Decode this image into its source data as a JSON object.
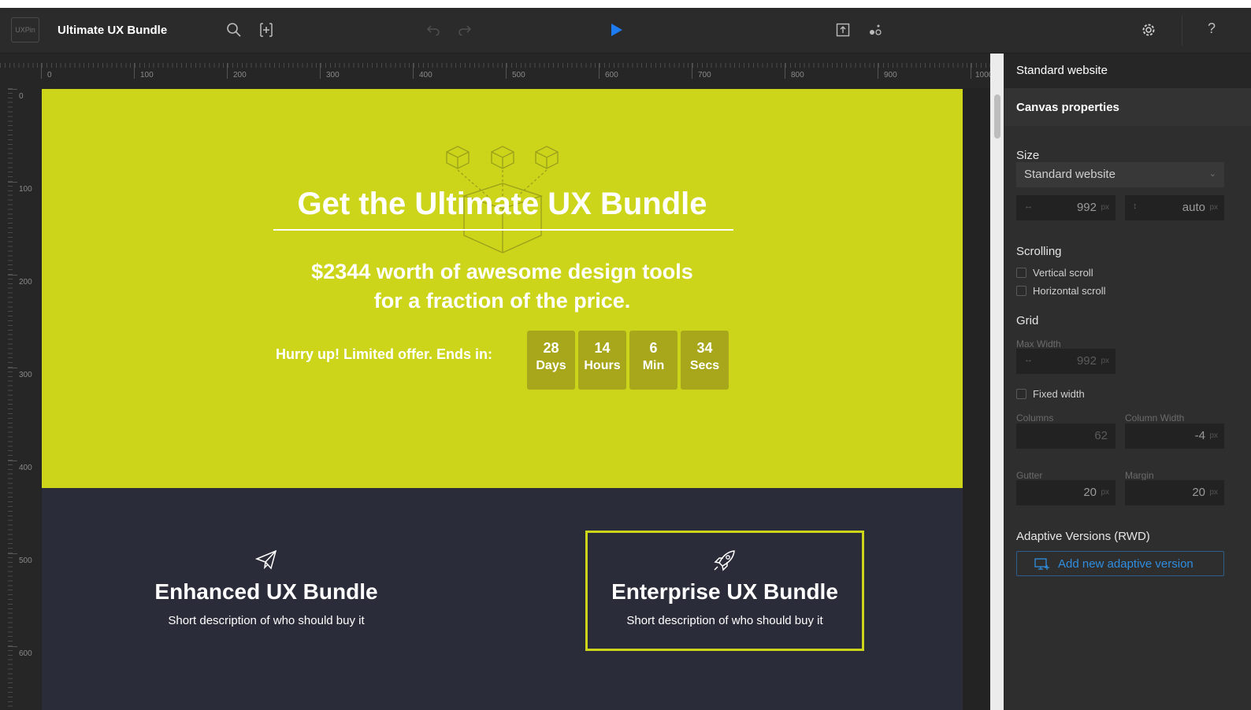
{
  "app": {
    "logo_text": "UXPin",
    "project_title": "Ultimate UX Bundle"
  },
  "toolbar": {
    "icons": [
      "search-icon",
      "add-frame-icon",
      "undo-icon",
      "redo-icon",
      "play-icon",
      "export-icon",
      "share-icon",
      "settings-icon",
      "help-icon"
    ],
    "help_label": "?"
  },
  "ruler": {
    "h_labels": [
      "0",
      "100",
      "200",
      "300",
      "400",
      "500",
      "600",
      "700",
      "800",
      "900",
      "1000"
    ],
    "v_labels": [
      "0",
      "100",
      "200",
      "300",
      "400",
      "500",
      "600"
    ]
  },
  "canvas": {
    "hero": {
      "title": "Get the Ultimate UX Bundle",
      "subtitle_line1": "$2344 worth of awesome design tools",
      "subtitle_line2": "for a fraction of the price.",
      "hurry_text": "Hurry up! Limited offer. Ends in:",
      "countdown": [
        {
          "num": "28",
          "unit": "Days"
        },
        {
          "num": "14",
          "unit": "Hours"
        },
        {
          "num": "6",
          "unit": "Min"
        },
        {
          "num": "34",
          "unit": "Secs"
        }
      ]
    },
    "bundles": [
      {
        "title": "Enhanced UX Bundle",
        "desc": "Short description of who should buy it",
        "icon": "paper-plane-icon"
      },
      {
        "title": "Enterprise UX Bundle",
        "desc": "Short description of who should buy it",
        "icon": "rocket-icon"
      }
    ],
    "colors": {
      "accent": "#cdd51b",
      "dark": "#2b2c39",
      "countdown": "#a8a71c"
    }
  },
  "panel": {
    "header": "Standard website",
    "section_title": "Canvas properties",
    "size": {
      "label": "Size",
      "select_value": "Standard website",
      "width_value": "992",
      "height_value": "auto",
      "unit": "px"
    },
    "scrolling": {
      "label": "Scrolling",
      "vertical": "Vertical scroll",
      "horizontal": "Horizontal scroll"
    },
    "grid": {
      "label": "Grid",
      "max_width_label": "Max Width",
      "max_width_value": "992",
      "fixed_width": "Fixed width",
      "columns_label": "Columns",
      "columns_value": "62",
      "column_width_label": "Column Width",
      "column_width_value": "-4",
      "gutter_label": "Gutter",
      "gutter_value": "20",
      "margin_label": "Margin",
      "margin_value": "20"
    },
    "adaptive": {
      "label": "Adaptive Versions (RWD)",
      "button": "Add new adaptive version"
    }
  }
}
